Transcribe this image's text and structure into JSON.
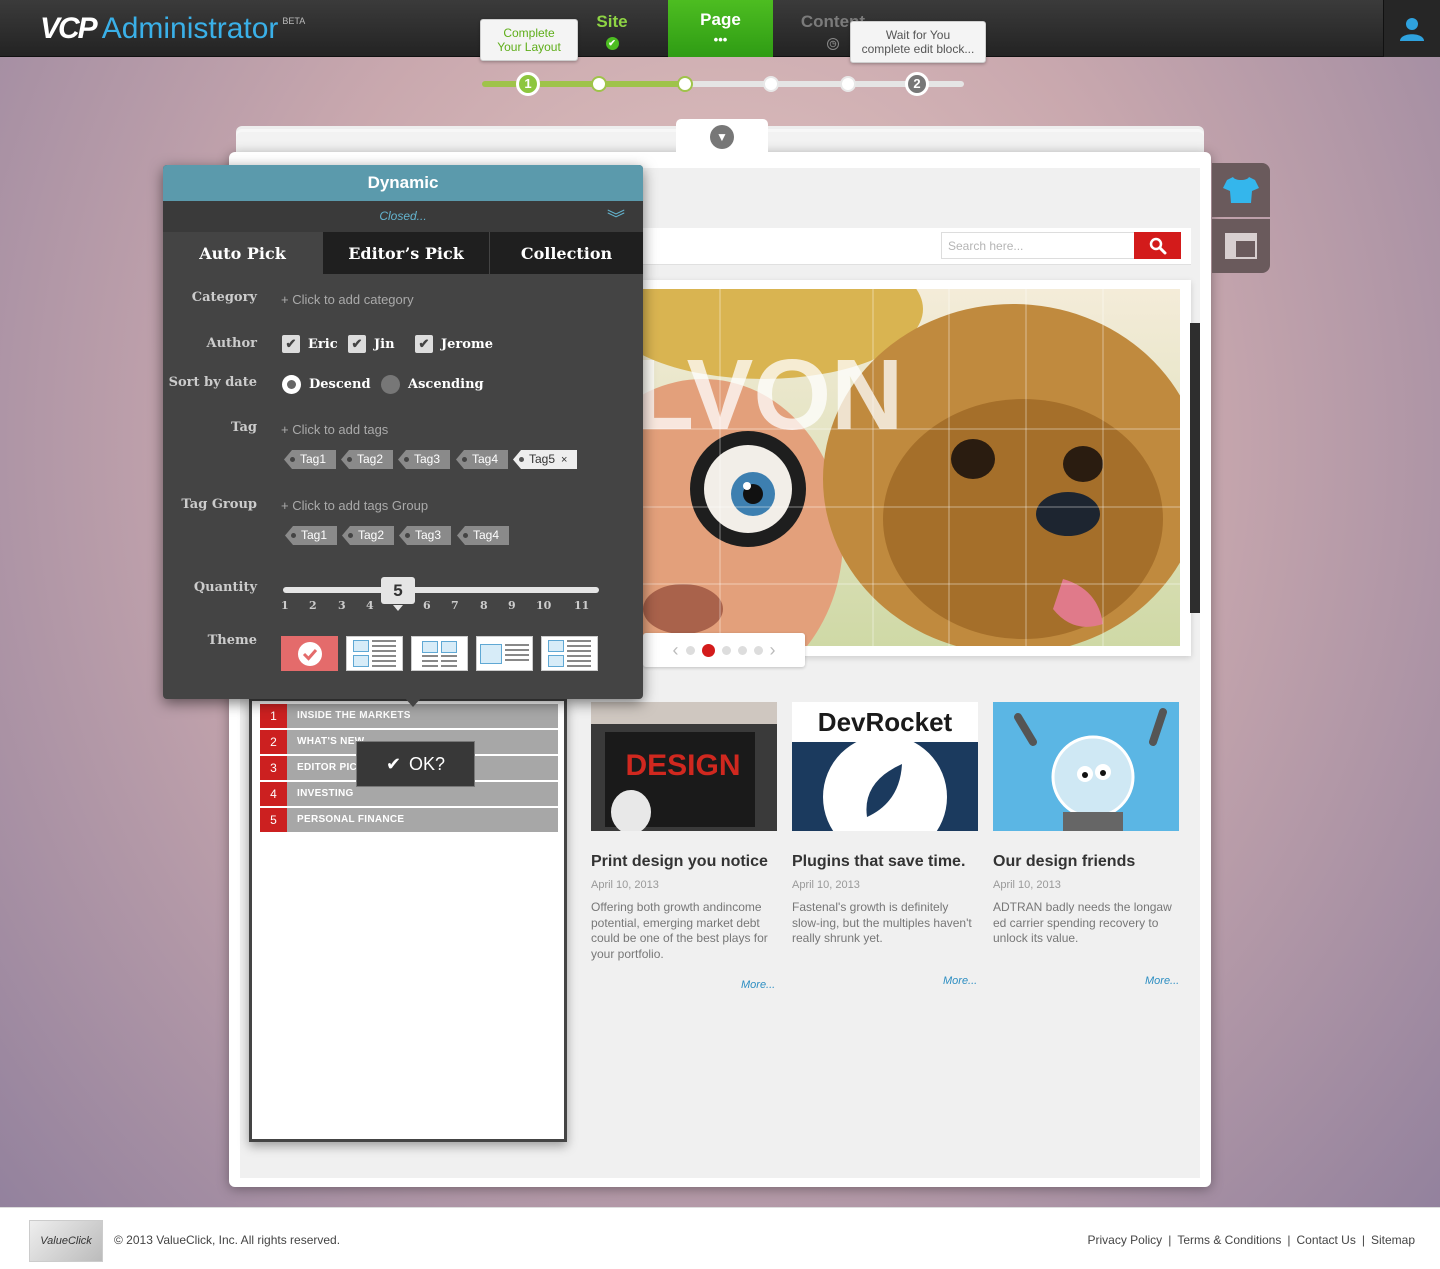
{
  "header": {
    "logo_main": "VCP",
    "logo_sub": "Administrator",
    "logo_badge": "BETA",
    "nav": {
      "site": "Site",
      "page": "Page",
      "page_sub": "•••",
      "content": "Content"
    },
    "tip_step1": "Complete\nYour Layout",
    "tip_step2": "Wait for You\ncomplete edit block...",
    "step1_num": "1",
    "step2_num": "2",
    "active_nav": "page"
  },
  "site_header": {
    "search_placeholder": "Search here..."
  },
  "dynamic_panel": {
    "title": "Dynamic",
    "status": "Closed...",
    "tabs": [
      "Auto Pick",
      "Editor’s Pick",
      "Collection"
    ],
    "active_tab": "Auto Pick",
    "labels": {
      "category": "Category",
      "author": "Author",
      "sort": "Sort by date",
      "tag": "Tag",
      "tag_group": "Tag Group",
      "quantity": "Quantity",
      "theme": "Theme"
    },
    "add_category": "+ Click to add category",
    "add_tags": "+ Click to add tags",
    "add_tag_group": "+ Click to add tags Group",
    "authors": [
      {
        "name": "Eric",
        "checked": true
      },
      {
        "name": "Jin",
        "checked": true
      },
      {
        "name": "Jerome",
        "checked": true
      }
    ],
    "sort": {
      "descend": "Descend",
      "ascending": "Ascending",
      "selected": "Descend"
    },
    "tags": [
      "Tag1",
      "Tag2",
      "Tag3",
      "Tag4",
      "Tag5"
    ],
    "tag_selected": "Tag5",
    "tag_remove": "×",
    "tag_groups": [
      "Tag1",
      "Tag2",
      "Tag3",
      "Tag4"
    ],
    "quantity_value": "5",
    "quantity_ticks": [
      "1",
      "2",
      "3",
      "4",
      "6",
      "7",
      "8",
      "9",
      "10",
      "11"
    ],
    "theme_selected_index": 0
  },
  "list_widget": {
    "items": [
      {
        "num": "1",
        "label": "INSIDE THE MARKETS"
      },
      {
        "num": "2",
        "label": "WHAT'S NEW"
      },
      {
        "num": "3",
        "label": "EDITOR PICKS"
      },
      {
        "num": "4",
        "label": "INVESTING"
      },
      {
        "num": "5",
        "label": "PERSONAL FINANCE"
      }
    ],
    "ok_label": "OK?"
  },
  "hero": {
    "overlay_text": "LVON",
    "active_slide": 1
  },
  "cards": [
    {
      "title": "Print design you notice",
      "date": "April 10, 2013",
      "text": "Offering both growth andincome potential, emerging market debt could be one of the best plays for your portfolio.",
      "more": "More...",
      "image_text": "DESIGN"
    },
    {
      "title": "Plugins that save time.",
      "date": "April 10, 2013",
      "text": "Fastenal's growth is definitely slow-ing, but the multiples haven't really shrunk yet.",
      "more": "More...",
      "image_text": "DevRocket"
    },
    {
      "title": "Our design friends",
      "date": "April 10, 2013",
      "text": "ADTRAN badly needs the longaw ed carrier spending recovery to unlock its value.",
      "more": "More...",
      "image_text": ""
    }
  ],
  "footer": {
    "logo_text": "ValueClick",
    "copyright": "© 2013 ValueClick, Inc. All rights reserved.",
    "links": [
      "Privacy Policy",
      "Terms & Conditions",
      "Contact Us",
      "Sitemap"
    ]
  },
  "colors": {
    "accent_blue": "#3ab0e8",
    "nav_green": "#4dbd21",
    "panel_teal": "#5b9aac",
    "brand_red": "#d31b1b"
  }
}
